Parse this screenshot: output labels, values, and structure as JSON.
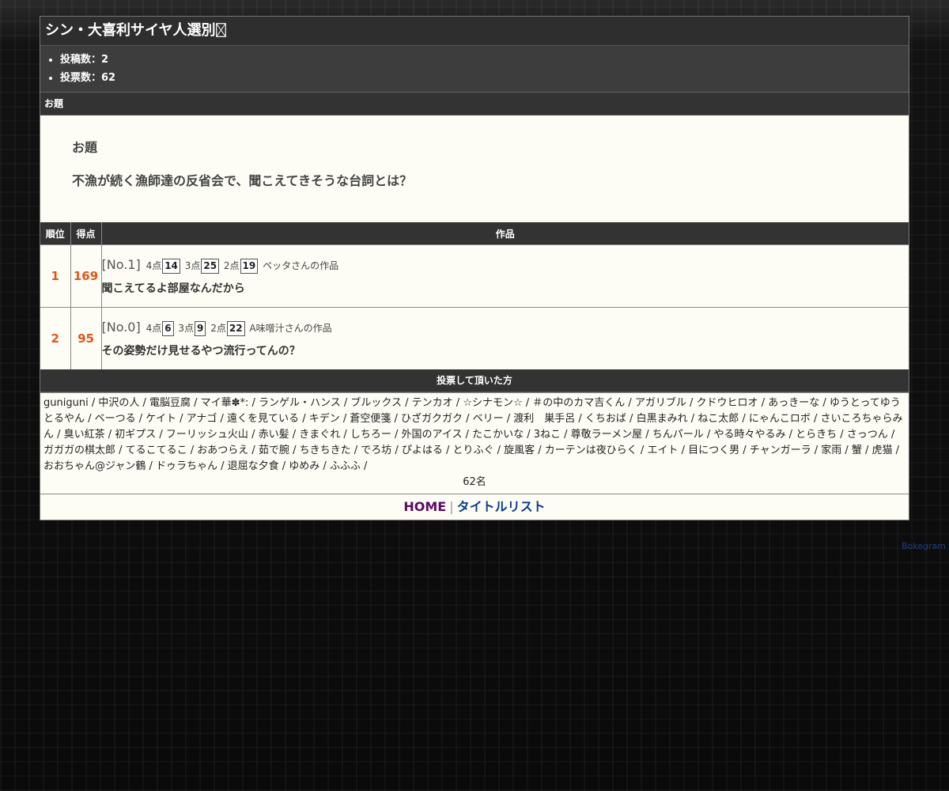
{
  "title": "シン・大喜利サイヤ人選別",
  "title_icon": "missing-glyph-box",
  "stats": [
    {
      "label": "投稿数：",
      "value": "2"
    },
    {
      "label": "投票数：",
      "value": "62"
    }
  ],
  "odai_section": {
    "header": "お題",
    "label": "お題",
    "text": "不漁が続く漁師達の反省会で、聞こえてきそうな台詞とは？"
  },
  "results_table": {
    "headers": {
      "rank": "順位",
      "score": "得点",
      "work": "作品"
    },
    "rows": [
      {
        "rank": "1",
        "score": "169",
        "no": "[No.1]",
        "p4_label": "4点",
        "p4": "14",
        "p3_label": "3点",
        "p3": "25",
        "p2_label": "2点",
        "p2": "19",
        "author": "ペッタさんの作品",
        "text": "聞こえてるよ部屋なんだから"
      },
      {
        "rank": "2",
        "score": "95",
        "no": "[No.0]",
        "p4_label": "4点",
        "p4": "6",
        "p3_label": "3点",
        "p3": "9",
        "p2_label": "2点",
        "p2": "22",
        "author": "A味噌汁さんの作品",
        "text": "その姿勢だけ見せるやつ流行ってんの？"
      }
    ]
  },
  "voters": {
    "header": "投票して頂いた方",
    "names": "guniguni / 中沢の人 / 電脳豆腐 / マイ華✽*: / ランゲル・ハンス / ブルックス / テンカオ / ☆シナモン☆ / ＃の中のカマ吉くん / アガリブル / クドウヒロオ / あっきーな / ゆうとってゆうとるやん / ベーつる / ケイト / アナゴ / 遠くを見ている / キデン / 蒼空便箋 / ひざガクガク / ベリー / 渡利　巣手呂 / くちおば / 白黒まみれ / ねこ太郎 / にゃんこロボ / さいころちゃらみん / 臭い紅茶 / 初ギプス / フーリッシュ火山 / 赤い髪 / きまぐれ / しちろー / 外国のアイス / たこかいな / 3ねこ / 尊敬ラーメン屋 / ちんパール / やる時々やるみ / とらきち / さっつん / ガガガの棋太郎 / てるこてるこ / おあつらえ / 茹で腕 / ちきちきた / でろ坊 / ぴよはる / とりふぐ / 旋風客 / カーテンは夜ひらく / エイト / 目につく男 / チャンガーラ / 家雨 / 蟹 / 虎猫 / おおちゃん@ジャン鶴 / ドゥラちゃん / 退屈な夕食 / ゆめみ / ふふふ /",
    "count": "62名"
  },
  "nav": {
    "home": "HOME",
    "separator": "|",
    "title_list": "タイトルリスト"
  },
  "bokegram_link": "Bokegram",
  "colors": {
    "rank_score": "#e0561c",
    "home_link": "#5a0b62",
    "list_link": "#0b3d8c",
    "header_bg": "#333333",
    "panel_bg": "#fdfdf6"
  }
}
